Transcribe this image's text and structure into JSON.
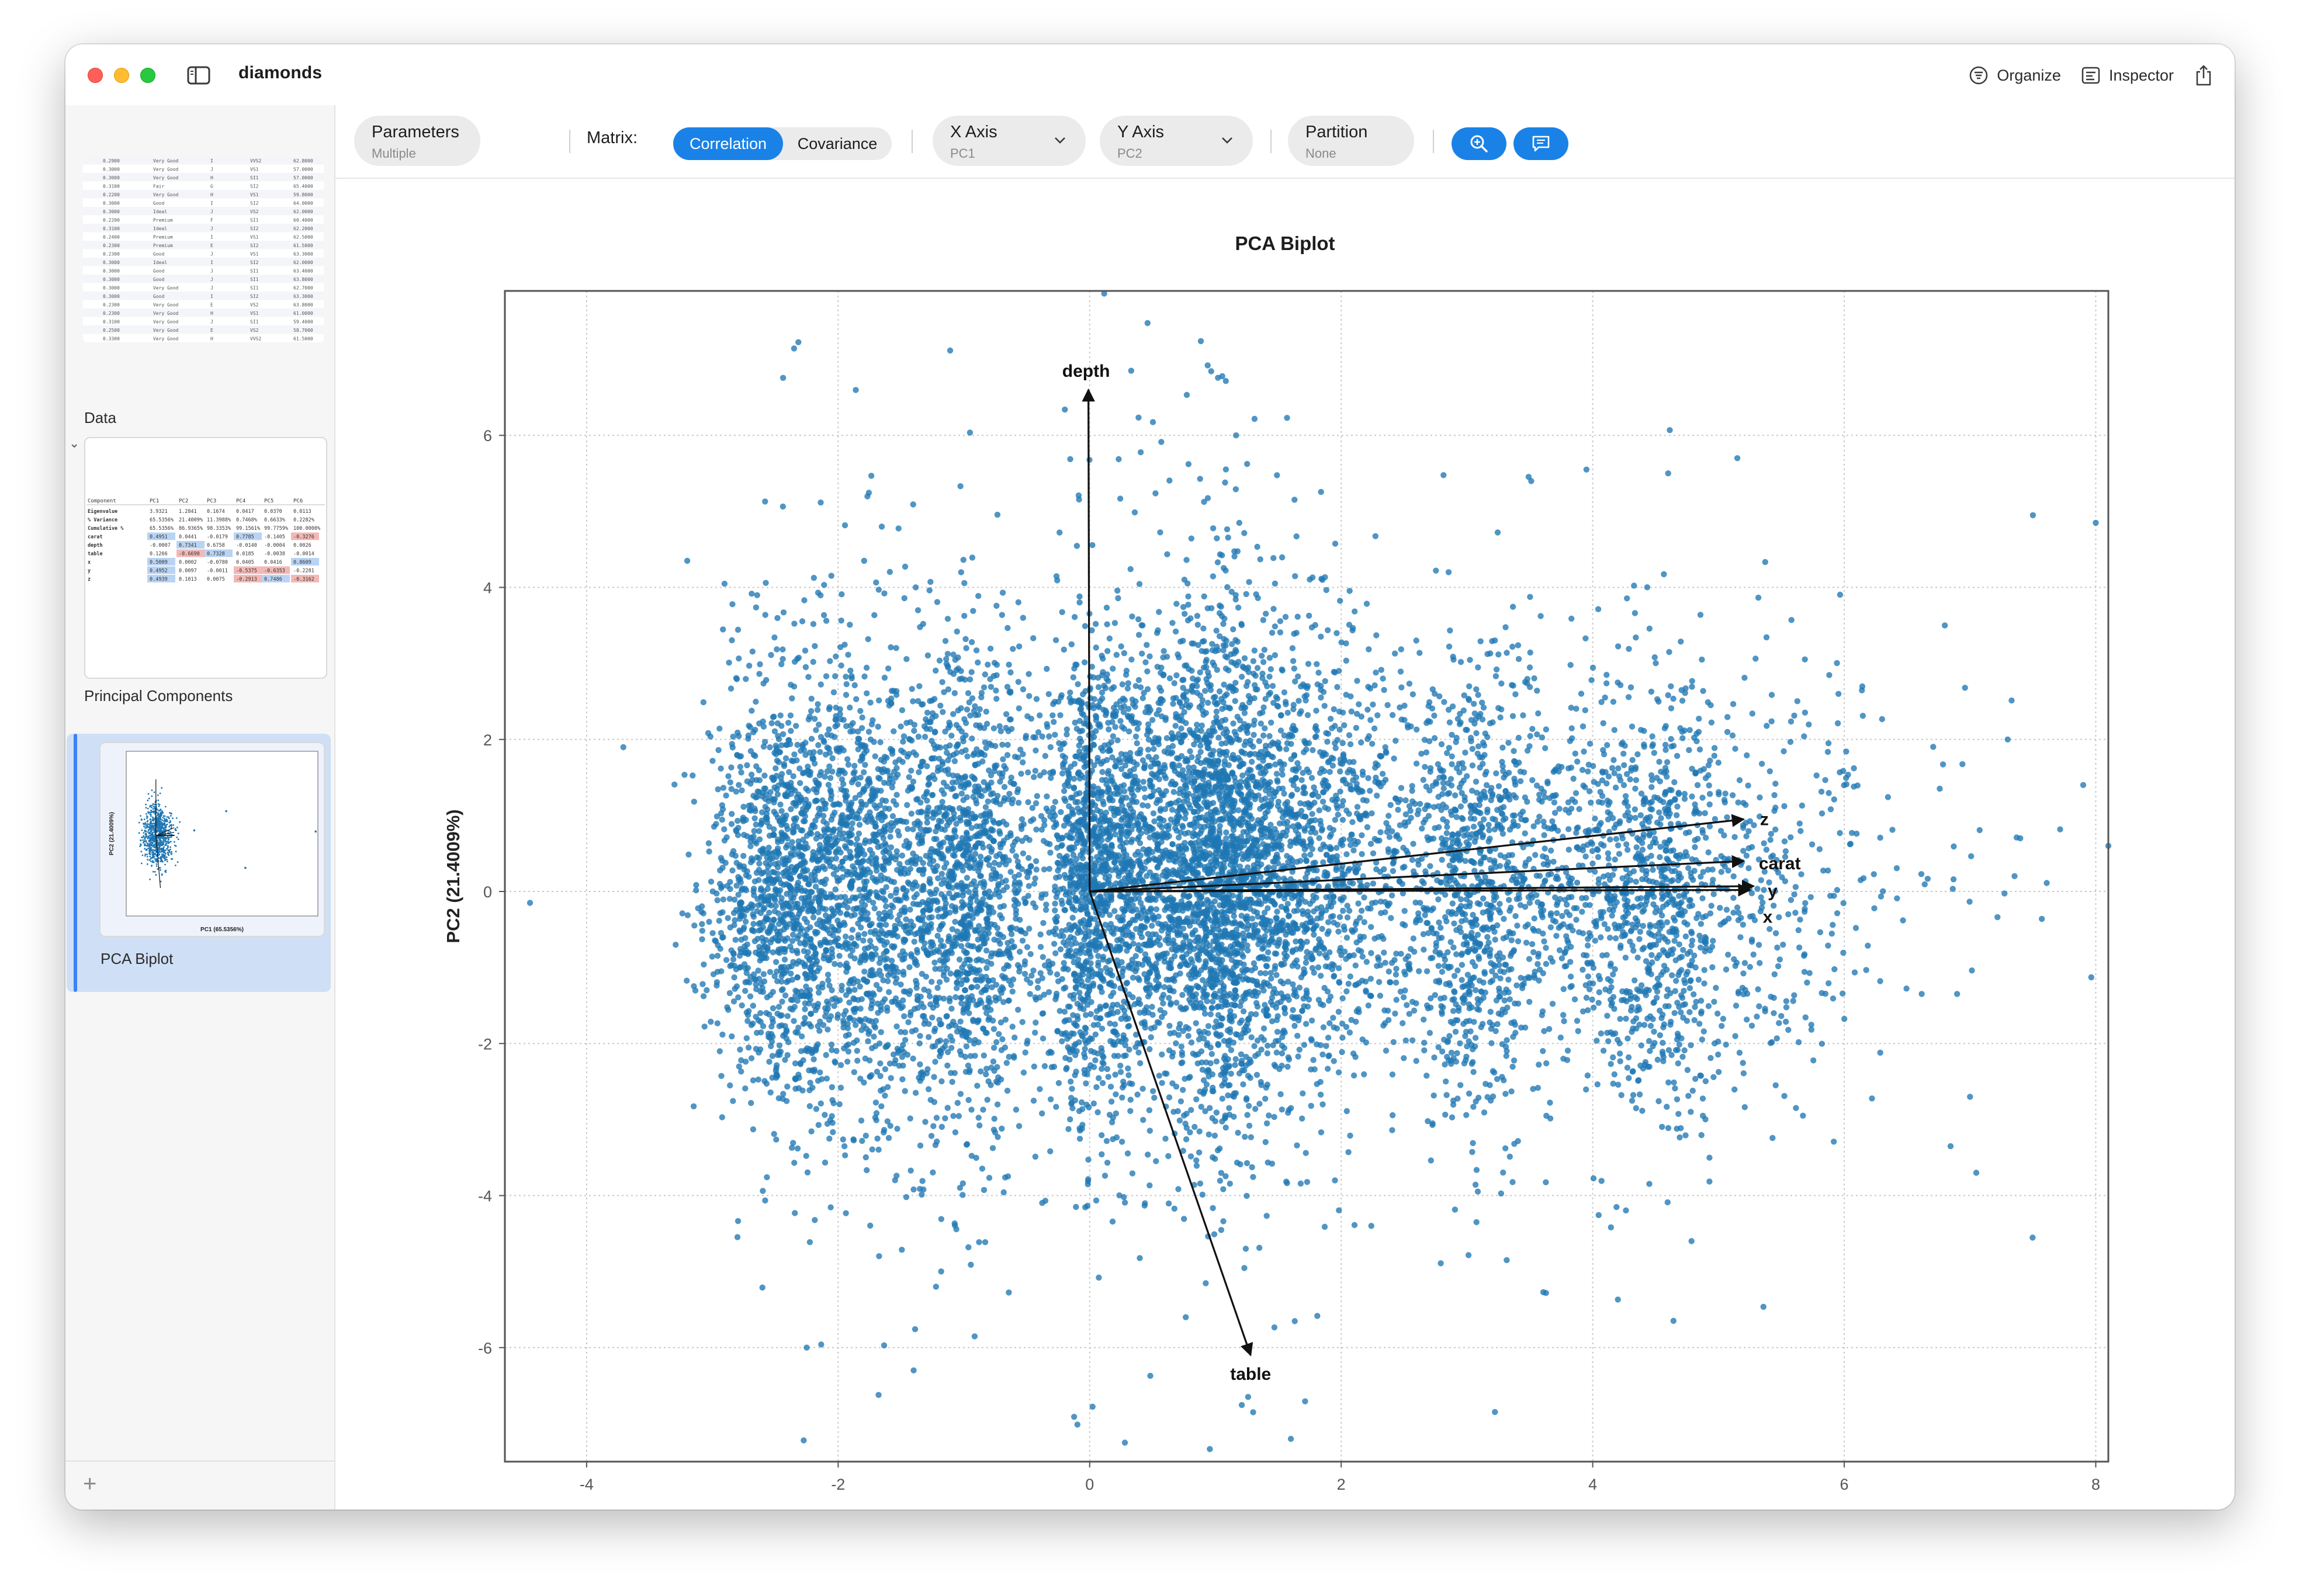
{
  "window": {
    "title": "diamonds",
    "toolbar_right": {
      "organize": "Organize",
      "inspector": "Inspector"
    }
  },
  "sidebar": {
    "items": [
      {
        "label": "Data"
      },
      {
        "label": "Principal Components"
      },
      {
        "label": "PCA Biplot"
      }
    ],
    "data_table_rows": [
      [
        "0.2900",
        "Very Good",
        "I",
        "VVS2",
        "62.8000"
      ],
      [
        "0.3000",
        "Very Good",
        "J",
        "VS1",
        "57.0000"
      ],
      [
        "0.3000",
        "Very Good",
        "H",
        "SI1",
        "57.0000"
      ],
      [
        "0.3100",
        "Fair",
        "G",
        "SI2",
        "65.4000"
      ],
      [
        "0.2200",
        "Very Good",
        "H",
        "VS1",
        "59.8000"
      ],
      [
        "0.3000",
        "Good",
        "I",
        "SI2",
        "64.0000"
      ],
      [
        "0.3000",
        "Ideal",
        "J",
        "VS2",
        "62.0000"
      ],
      [
        "0.2200",
        "Premium",
        "F",
        "SI1",
        "60.4000"
      ],
      [
        "0.3100",
        "Ideal",
        "J",
        "SI2",
        "62.2000"
      ],
      [
        "0.2400",
        "Premium",
        "I",
        "VS1",
        "62.5000"
      ],
      [
        "0.2300",
        "Premium",
        "E",
        "SI2",
        "61.5000"
      ],
      [
        "0.2300",
        "Good",
        "J",
        "VS1",
        "63.3000"
      ],
      [
        "0.3000",
        "Ideal",
        "I",
        "SI2",
        "62.0000"
      ],
      [
        "0.3000",
        "Good",
        "J",
        "SI1",
        "63.4000"
      ],
      [
        "0.3000",
        "Good",
        "J",
        "SI1",
        "63.8000"
      ],
      [
        "0.3000",
        "Very Good",
        "J",
        "SI1",
        "62.7000"
      ],
      [
        "0.3000",
        "Good",
        "I",
        "SI2",
        "63.3000"
      ],
      [
        "0.2300",
        "Very Good",
        "E",
        "VS2",
        "63.8000"
      ],
      [
        "0.2300",
        "Very Good",
        "H",
        "VS1",
        "61.0000"
      ],
      [
        "0.3100",
        "Very Good",
        "J",
        "SI1",
        "59.4000"
      ],
      [
        "0.2500",
        "Very Good",
        "E",
        "VS2",
        "58.7000"
      ],
      [
        "0.3300",
        "Very Good",
        "H",
        "VVS2",
        "61.5000"
      ],
      [
        "0.2300",
        "Premium",
        "I",
        "VS1",
        "62.7000"
      ],
      [
        "0.3000",
        "Very Good",
        "J",
        "VS2",
        "61.8000"
      ],
      [
        "0.3200",
        "Very Good",
        "H",
        "VS2",
        "62.3000"
      ],
      [
        "0.2200",
        "Very Good",
        "F",
        "VS2",
        "60.4000"
      ],
      [
        "0.2200",
        "Very Good",
        "F",
        "VS2",
        "59.6000"
      ],
      [
        "0.2100",
        "Very Good",
        "F",
        "SI1",
        "58.8000"
      ]
    ],
    "pc_table": {
      "headers": [
        "Component",
        "PC1",
        "PC2",
        "PC3",
        "PC4",
        "PC5",
        "PC6"
      ],
      "rows": [
        [
          "Eigenvalue",
          "3.9321",
          "1.2841",
          "0.1674",
          "0.0417",
          "0.0370",
          "0.0113"
        ],
        [
          "% Variance",
          "65.5356%",
          "21.4009%",
          "11.3988%",
          "0.7468%",
          "0.6633%",
          "0.2282%"
        ],
        [
          "Cumulative %",
          "65.5356%",
          "86.9365%",
          "98.3353%",
          "99.1561%",
          "99.7759%",
          "100.0000%"
        ],
        [
          "carat",
          "0.4951",
          "0.0441",
          "-0.0179",
          "0.7785",
          "-0.1405",
          "-0.3276"
        ],
        [
          "depth",
          "-0.0007",
          "0.7341",
          "0.6758",
          "-0.0140",
          "-0.0004",
          "0.0026"
        ],
        [
          "table",
          "0.1266",
          "-0.6690",
          "0.7328",
          "0.0185",
          "-0.0038",
          "-0.0014"
        ],
        [
          "x",
          "0.5009",
          "0.0002",
          "-0.0780",
          "0.0405",
          "0.0416",
          "0.8609"
        ],
        [
          "y",
          "0.4952",
          "0.0097",
          "-0.0011",
          "-0.5375",
          "-0.6353",
          "-0.2281"
        ],
        [
          "z",
          "0.4939",
          "0.1013",
          "0.0075",
          "-0.2913",
          "0.7486",
          "-0.3162"
        ]
      ]
    }
  },
  "toolbar": {
    "parameters": {
      "title": "Parameters",
      "sub": "Multiple"
    },
    "matrix_label": "Matrix:",
    "matrix_options": [
      "Correlation",
      "Covariance"
    ],
    "matrix_selected": "Correlation",
    "x_axis": {
      "title": "X Axis",
      "value": "PC1"
    },
    "y_axis": {
      "title": "Y Axis",
      "value": "PC2"
    },
    "partition": {
      "title": "Partition",
      "value": "None"
    }
  },
  "colors": {
    "accent": "#1a82e6",
    "points": "#1f77b4",
    "selection": "#cfdff6"
  },
  "icons": {
    "close": "close-traffic-light",
    "minimize": "minimize-traffic-light",
    "zoom": "zoom-traffic-light",
    "sidebar": "sidebar-toggle-icon",
    "organize": "organize-icon",
    "inspector": "inspector-icon",
    "share": "share-icon",
    "zoom_tool": "magnifier-zoom-icon",
    "comment": "comment-icon",
    "chevron": "chevron-down-icon",
    "add": "plus-icon"
  },
  "chart_data": {
    "type": "scatter",
    "title": "PCA Biplot",
    "xlabel": "PC1 (65.5356%)",
    "ylabel": "PC2 (21.4009%)",
    "xlim": [
      -4.65,
      8.1
    ],
    "ylim": [
      -7.5,
      7.9
    ],
    "xticks": [
      -4,
      -2,
      0,
      2,
      4,
      6,
      8
    ],
    "yticks": [
      -6,
      -4,
      -2,
      0,
      2,
      4,
      6
    ],
    "grid": true,
    "n_points_approx": 53940,
    "point_clusters": [
      {
        "center": [
          -2.45,
          0.0
        ],
        "sx": 0.3,
        "sy": 1.35,
        "n": 1100
      },
      {
        "center": [
          -1.8,
          0.1
        ],
        "sx": 0.35,
        "sy": 1.55,
        "n": 1200
      },
      {
        "center": [
          -0.95,
          0.0
        ],
        "sx": 0.3,
        "sy": 1.5,
        "n": 1300
      },
      {
        "center": [
          0.0,
          0.2
        ],
        "sx": 0.18,
        "sy": 1.55,
        "n": 1100
      },
      {
        "center": [
          0.5,
          0.3
        ],
        "sx": 0.22,
        "sy": 1.45,
        "n": 900
      },
      {
        "center": [
          1.0,
          0.5
        ],
        "sx": 0.2,
        "sy": 1.7,
        "n": 1100
      },
      {
        "center": [
          1.35,
          0.1
        ],
        "sx": 0.35,
        "sy": 1.55,
        "n": 1200
      },
      {
        "center": [
          2.0,
          0.4
        ],
        "sx": 0.4,
        "sy": 1.4,
        "n": 700
      },
      {
        "center": [
          3.05,
          0.0
        ],
        "sx": 0.28,
        "sy": 1.45,
        "n": 900
      },
      {
        "center": [
          3.8,
          0.3
        ],
        "sx": 0.3,
        "sy": 1.2,
        "n": 300
      },
      {
        "center": [
          4.5,
          -0.1
        ],
        "sx": 0.3,
        "sy": 1.45,
        "n": 850
      },
      {
        "center": [
          5.5,
          0.2
        ],
        "sx": 0.4,
        "sy": 1.35,
        "n": 260
      },
      {
        "center": [
          6.5,
          0.0
        ],
        "sx": 0.8,
        "sy": 1.5,
        "n": 45
      }
    ],
    "outliers": [
      [
        -4.45,
        -0.15
      ],
      [
        0.33,
        6.85
      ],
      [
        8.0,
        4.85
      ],
      [
        8.1,
        0.6
      ],
      [
        7.5,
        4.95
      ],
      [
        7.4,
        0.7
      ],
      [
        7.9,
        1.4
      ],
      [
        7.3,
        2.0
      ],
      [
        7.05,
        -3.7
      ],
      [
        7.0,
        -2.7
      ],
      [
        6.8,
        3.5
      ],
      [
        -3.2,
        4.35
      ],
      [
        -2.25,
        -6.0
      ],
      [
        -1.4,
        -6.3
      ],
      [
        1.6,
        -7.2
      ],
      [
        1.3,
        -6.85
      ],
      [
        0.28,
        -7.25
      ],
      [
        5.15,
        5.7
      ],
      [
        4.6,
        5.5
      ],
      [
        3.95,
        5.55
      ]
    ],
    "loadings": [
      {
        "name": "depth",
        "x": -0.01,
        "y": 6.6
      },
      {
        "name": "table",
        "x": 1.28,
        "y": -6.1
      },
      {
        "name": "z",
        "x": 5.2,
        "y": 0.95
      },
      {
        "name": "carat",
        "x": 5.2,
        "y": 0.4
      },
      {
        "name": "y",
        "x": 5.28,
        "y": 0.07
      },
      {
        "name": "x",
        "x": 5.25,
        "y": 0.02
      }
    ]
  }
}
